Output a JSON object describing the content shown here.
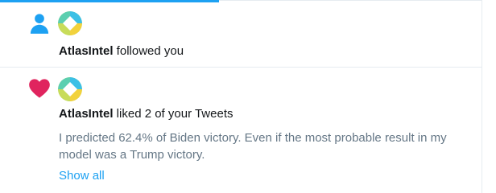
{
  "colors": {
    "accent": "#1da1f2",
    "like": "#e0245e",
    "muted": "#657786"
  },
  "notifications": [
    {
      "type_icon": "person-icon",
      "avatar_icon": "atlasintel-logo",
      "user": "AtlasIntel",
      "action": " followed you"
    },
    {
      "type_icon": "heart-icon",
      "avatar_icon": "atlasintel-logo",
      "user": "AtlasIntel",
      "action": " liked 2 of your Tweets",
      "tweet_text": "I predicted 62.4% of Biden victory. Even if the most probable result in my model was a Trump victory.",
      "show_all_label": "Show all"
    }
  ]
}
